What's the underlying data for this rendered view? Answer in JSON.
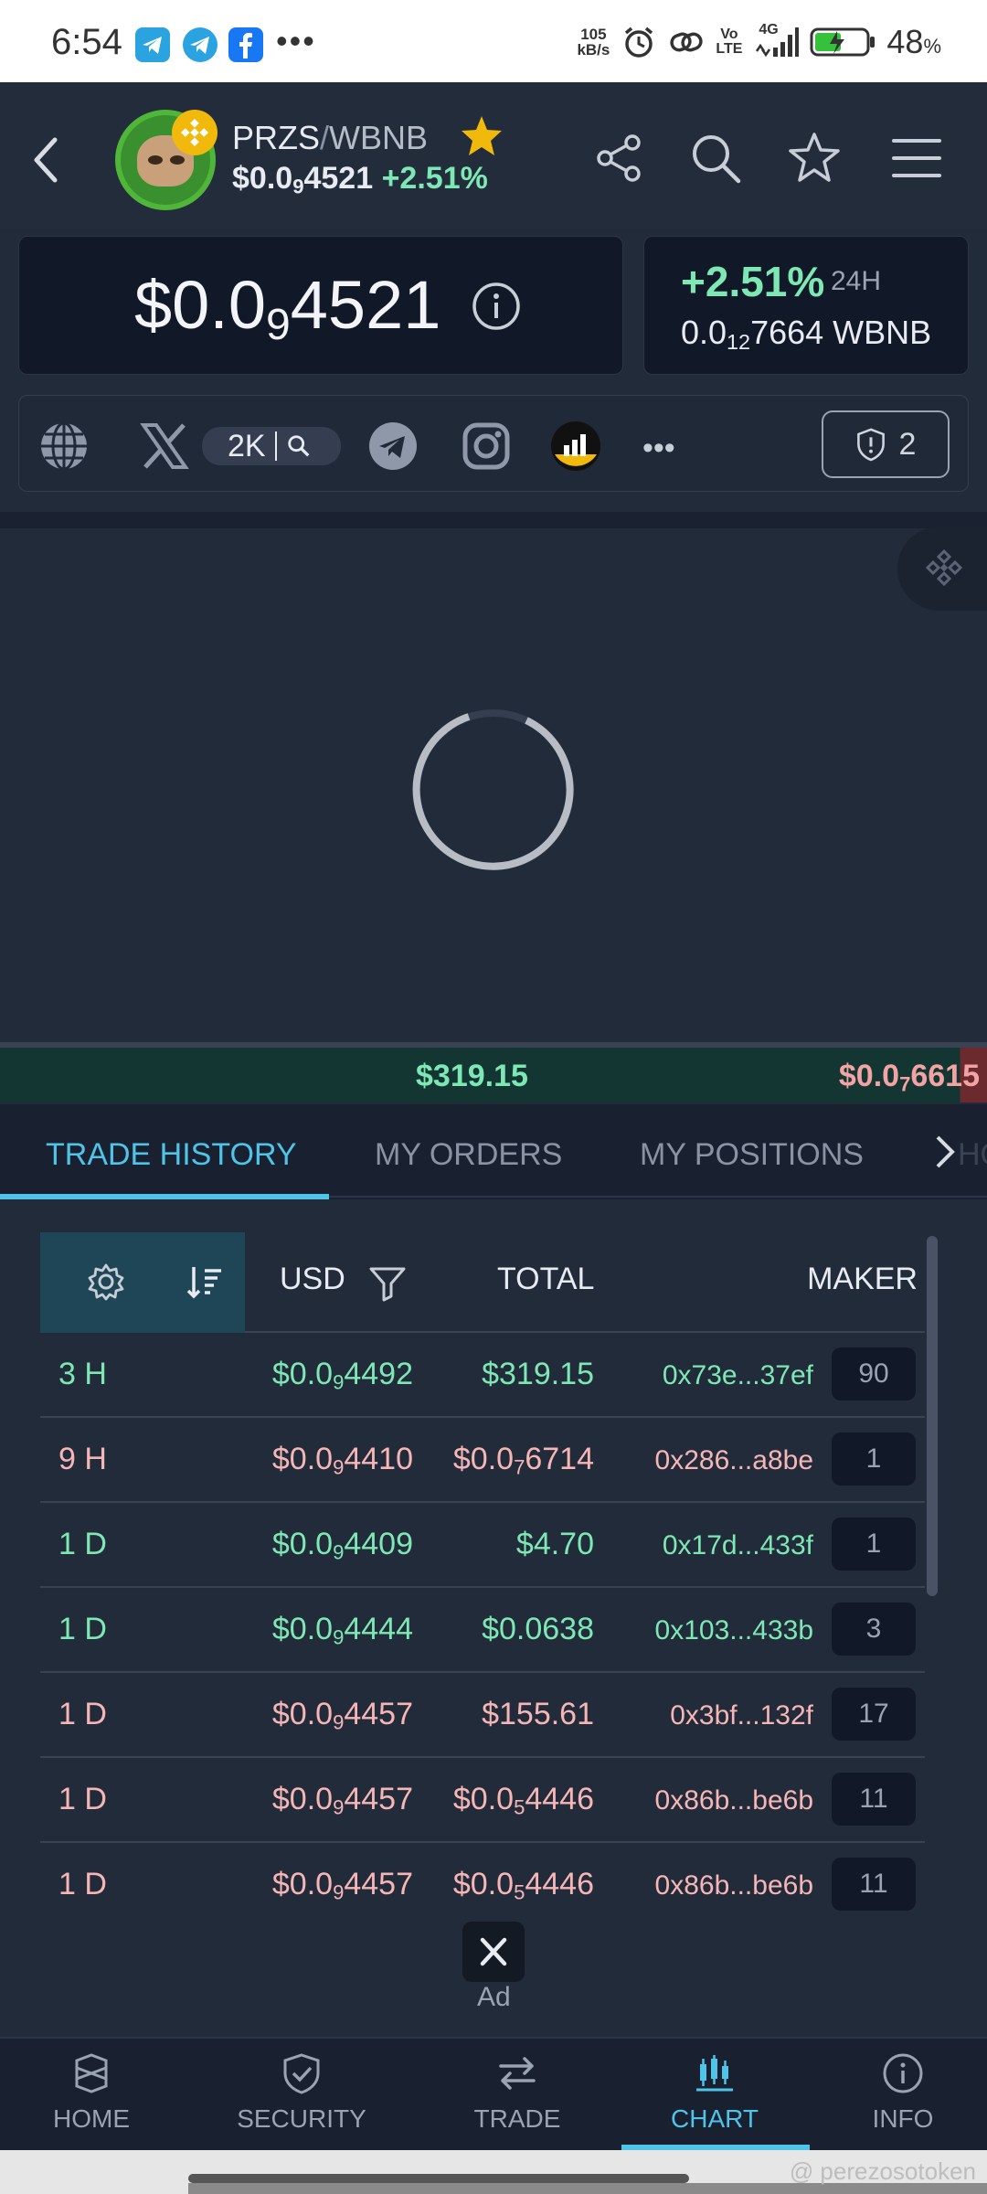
{
  "status_bar": {
    "time": "6:54",
    "speed_top": "105",
    "speed_unit": "kB/s",
    "volte_top": "Vo",
    "volte_bottom": "LTE",
    "network": "4G",
    "battery_pct": "48",
    "battery_pct_sign": "%"
  },
  "header": {
    "base": "PRZS",
    "separator": "/",
    "quote": "WBNB",
    "price_prefix": "$0.0",
    "price_sub": "9",
    "price_rest": "4521",
    "change": "+2.51%"
  },
  "price_card": {
    "prefix": "$0.0",
    "sub": "9",
    "rest": "4521"
  },
  "change_card": {
    "pct": "+2.51%",
    "period": "24H",
    "wbnb_prefix": "0.0",
    "wbnb_sub": "12",
    "wbnb_rest": "7664 WBNB"
  },
  "socials": {
    "x_count": "2K",
    "more": "•••",
    "audit_count": "2"
  },
  "ticker": {
    "buy_value": "$319.15",
    "sell_prefix": "$0.0",
    "sell_sub": "7",
    "sell_rest": "6615"
  },
  "tabs": {
    "trade_history": "TRADE HISTORY",
    "my_orders": "MY ORDERS",
    "my_positions": "MY POSITIONS",
    "ghost": "HO"
  },
  "table": {
    "headers": {
      "usd": "USD",
      "total": "TOTAL",
      "maker": "MAKER"
    },
    "rows": [
      {
        "age": "3 H",
        "usd_prefix": "$0.0",
        "usd_sub": "9",
        "usd_rest": "4492",
        "total_prefix": "$319.15",
        "total_sub": "",
        "total_rest": "",
        "maker": "0x73e...37ef",
        "count": "90",
        "side": "buy"
      },
      {
        "age": "9 H",
        "usd_prefix": "$0.0",
        "usd_sub": "9",
        "usd_rest": "4410",
        "total_prefix": "$0.0",
        "total_sub": "7",
        "total_rest": "6714",
        "maker": "0x286...a8be",
        "count": "1",
        "side": "sell"
      },
      {
        "age": "1 D",
        "usd_prefix": "$0.0",
        "usd_sub": "9",
        "usd_rest": "4409",
        "total_prefix": "$4.70",
        "total_sub": "",
        "total_rest": "",
        "maker": "0x17d...433f",
        "count": "1",
        "side": "buy"
      },
      {
        "age": "1 D",
        "usd_prefix": "$0.0",
        "usd_sub": "9",
        "usd_rest": "4444",
        "total_prefix": "$0.0638",
        "total_sub": "",
        "total_rest": "",
        "maker": "0x103...433b",
        "count": "3",
        "side": "buy"
      },
      {
        "age": "1 D",
        "usd_prefix": "$0.0",
        "usd_sub": "9",
        "usd_rest": "4457",
        "total_prefix": "$155.61",
        "total_sub": "",
        "total_rest": "",
        "maker": "0x3bf...132f",
        "count": "17",
        "side": "sell"
      },
      {
        "age": "1 D",
        "usd_prefix": "$0.0",
        "usd_sub": "9",
        "usd_rest": "4457",
        "total_prefix": "$0.0",
        "total_sub": "5",
        "total_rest": "4446",
        "maker": "0x86b...be6b",
        "count": "11",
        "side": "sell"
      },
      {
        "age": "1 D",
        "usd_prefix": "$0.0",
        "usd_sub": "9",
        "usd_rest": "4457",
        "total_prefix": "$0.0",
        "total_sub": "5",
        "total_rest": "4446",
        "maker": "0x86b...be6b",
        "count": "11",
        "side": "sell"
      }
    ]
  },
  "ad": {
    "label": "Ad"
  },
  "bottom_nav": {
    "home": "HOME",
    "security": "SECURITY",
    "trade": "TRADE",
    "chart": "CHART",
    "info": "INFO"
  },
  "watermark": "@ perezosotoken",
  "colors": {
    "buy": "#7ee8b5",
    "sell": "#f6b6b6",
    "accent": "#4fc3e8",
    "background": "#222b3a"
  }
}
